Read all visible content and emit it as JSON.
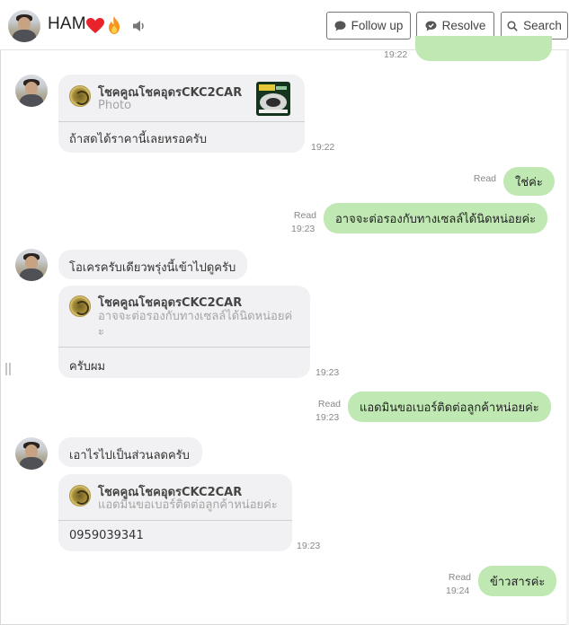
{
  "header": {
    "contact_name": "HAM",
    "follow_up_label": "Follow up",
    "resolve_label": "Resolve",
    "search_label": "Search"
  },
  "messages": {
    "top_partial_time": "19:22",
    "m1": {
      "reply_name": "โชคคูณโชคอุดรCKC2CAR",
      "reply_sub": "Photo",
      "text": "ถ้าสดได้ราคานี้เลยหรอครับ",
      "time": "19:22"
    },
    "m2": {
      "text": "ใช่ค่ะ",
      "read": "Read"
    },
    "m3": {
      "text": "อาจจะต่อรองกับทางเซลล์ได้นิดหน่อยค่ะ",
      "read": "Read",
      "time": "19:23"
    },
    "m4": {
      "text": "โอเครครับเดียวพรุ่งนี้เข้าไปดูครับ"
    },
    "m5": {
      "reply_name": "โชคคูณโชคอุดรCKC2CAR",
      "reply_sub_line1": "อาจจะต่อรองกับทางเซลล์ได้นิดหน่อยค่",
      "reply_sub_line2": "ะ",
      "text": "ครับผม",
      "time": "19:23"
    },
    "m6": {
      "text": "แอดมินขอเบอร์ติดต่อลูกค้าหน่อยค่ะ",
      "read": "Read",
      "time": "19:23"
    },
    "m7": {
      "text": "เอาไรไปเป็นส่วนลดครับ"
    },
    "m8": {
      "reply_name": "โชคคูณโชคอุดรCKC2CAR",
      "reply_sub": "แอดมินขอเบอร์ติดต่อลูกค้าหน่อยค่ะ",
      "text": "0959039341",
      "time": "19:23"
    },
    "m9": {
      "text": "ข้าวสารค่ะ",
      "read": "Read",
      "time": "19:24"
    }
  },
  "colors": {
    "outgoing_bubble": "#bfe8b3",
    "incoming_bubble": "#f1f1f3",
    "heart": "#e8232b",
    "fire": "#f7941d"
  },
  "icons": {
    "heart": "heart-icon",
    "fire": "fire-icon",
    "sound": "speaker-icon",
    "follow_up": "chat-bubble-icon",
    "resolve": "chat-check-icon",
    "search": "search-icon"
  }
}
